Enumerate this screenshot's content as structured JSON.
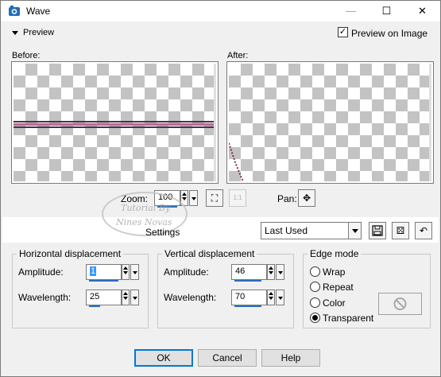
{
  "window": {
    "title": "Wave",
    "minimize_symbol": "—",
    "maximize_symbol": "☐",
    "close_symbol": "✕"
  },
  "preview": {
    "toggle_label": "Preview",
    "preview_on_image_label": "Preview on Image",
    "preview_on_image_checked": true,
    "check_mark": "✓"
  },
  "panes": {
    "before_label": "Before:",
    "after_label": "After:"
  },
  "zoom": {
    "label": "Zoom:",
    "value": "100",
    "fit_symbol": "⛶",
    "one_to_one_symbol": "1:1"
  },
  "pan": {
    "label": "Pan:",
    "symbol": "✥"
  },
  "settings": {
    "label": "Settings",
    "preset_value": "Last Used",
    "save_symbol": "💾",
    "random_symbol": "⚄",
    "reset_symbol": "↶"
  },
  "watermark": {
    "line1": "Tutorial By",
    "line2": "Nines Novas"
  },
  "horizontal": {
    "title": "Horizontal displacement",
    "amplitude_label": "Amplitude:",
    "amplitude_value": "1",
    "wavelength_label": "Wavelength:",
    "wavelength_value": "25"
  },
  "vertical": {
    "title": "Vertical displacement",
    "amplitude_label": "Amplitude:",
    "amplitude_value": "46",
    "wavelength_label": "Wavelength:",
    "wavelength_value": "70"
  },
  "edge_mode": {
    "title": "Edge mode",
    "options": [
      "Wrap",
      "Repeat",
      "Color",
      "Transparent"
    ],
    "selected": "Transparent",
    "no_color_symbol": "⊘"
  },
  "buttons": {
    "ok": "OK",
    "cancel": "Cancel",
    "help": "Help"
  },
  "colors": {
    "accent": "#0078d7",
    "line_pink": "#b26d96",
    "line_dark": "#5a2a45",
    "checker": "#c3c3c3"
  }
}
